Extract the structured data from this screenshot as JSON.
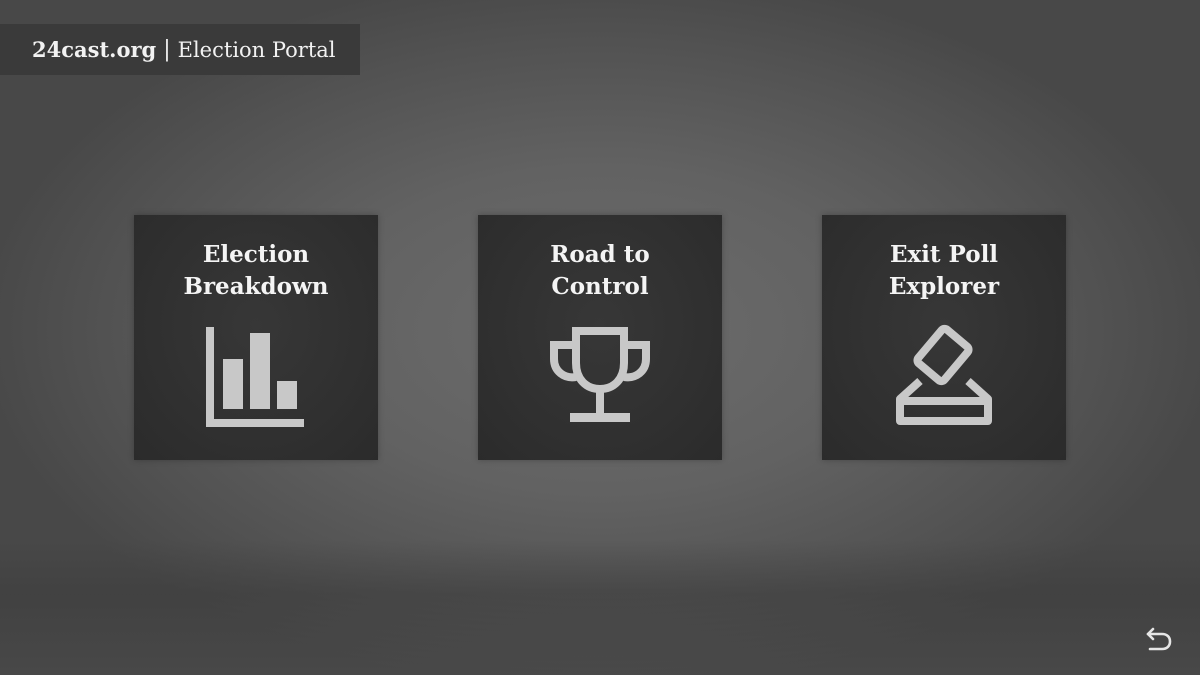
{
  "header": {
    "brand": "24cast.org",
    "separator": "|",
    "subtitle": "Election Portal"
  },
  "tiles": [
    {
      "line1": "Election",
      "line2": "Breakdown",
      "icon": "bar-chart-icon"
    },
    {
      "line1": "Road to",
      "line2": "Control",
      "icon": "trophy-icon"
    },
    {
      "line1": "Exit Poll",
      "line2": "Explorer",
      "icon": "ballot-box-icon"
    }
  ],
  "back": {
    "icon": "back-arrow-icon"
  },
  "colors": {
    "tile_bg": "#2f2f2f",
    "icon": "#c8c8c8",
    "header_bg": "#3a3a3a",
    "text": "#f4f4f4"
  }
}
